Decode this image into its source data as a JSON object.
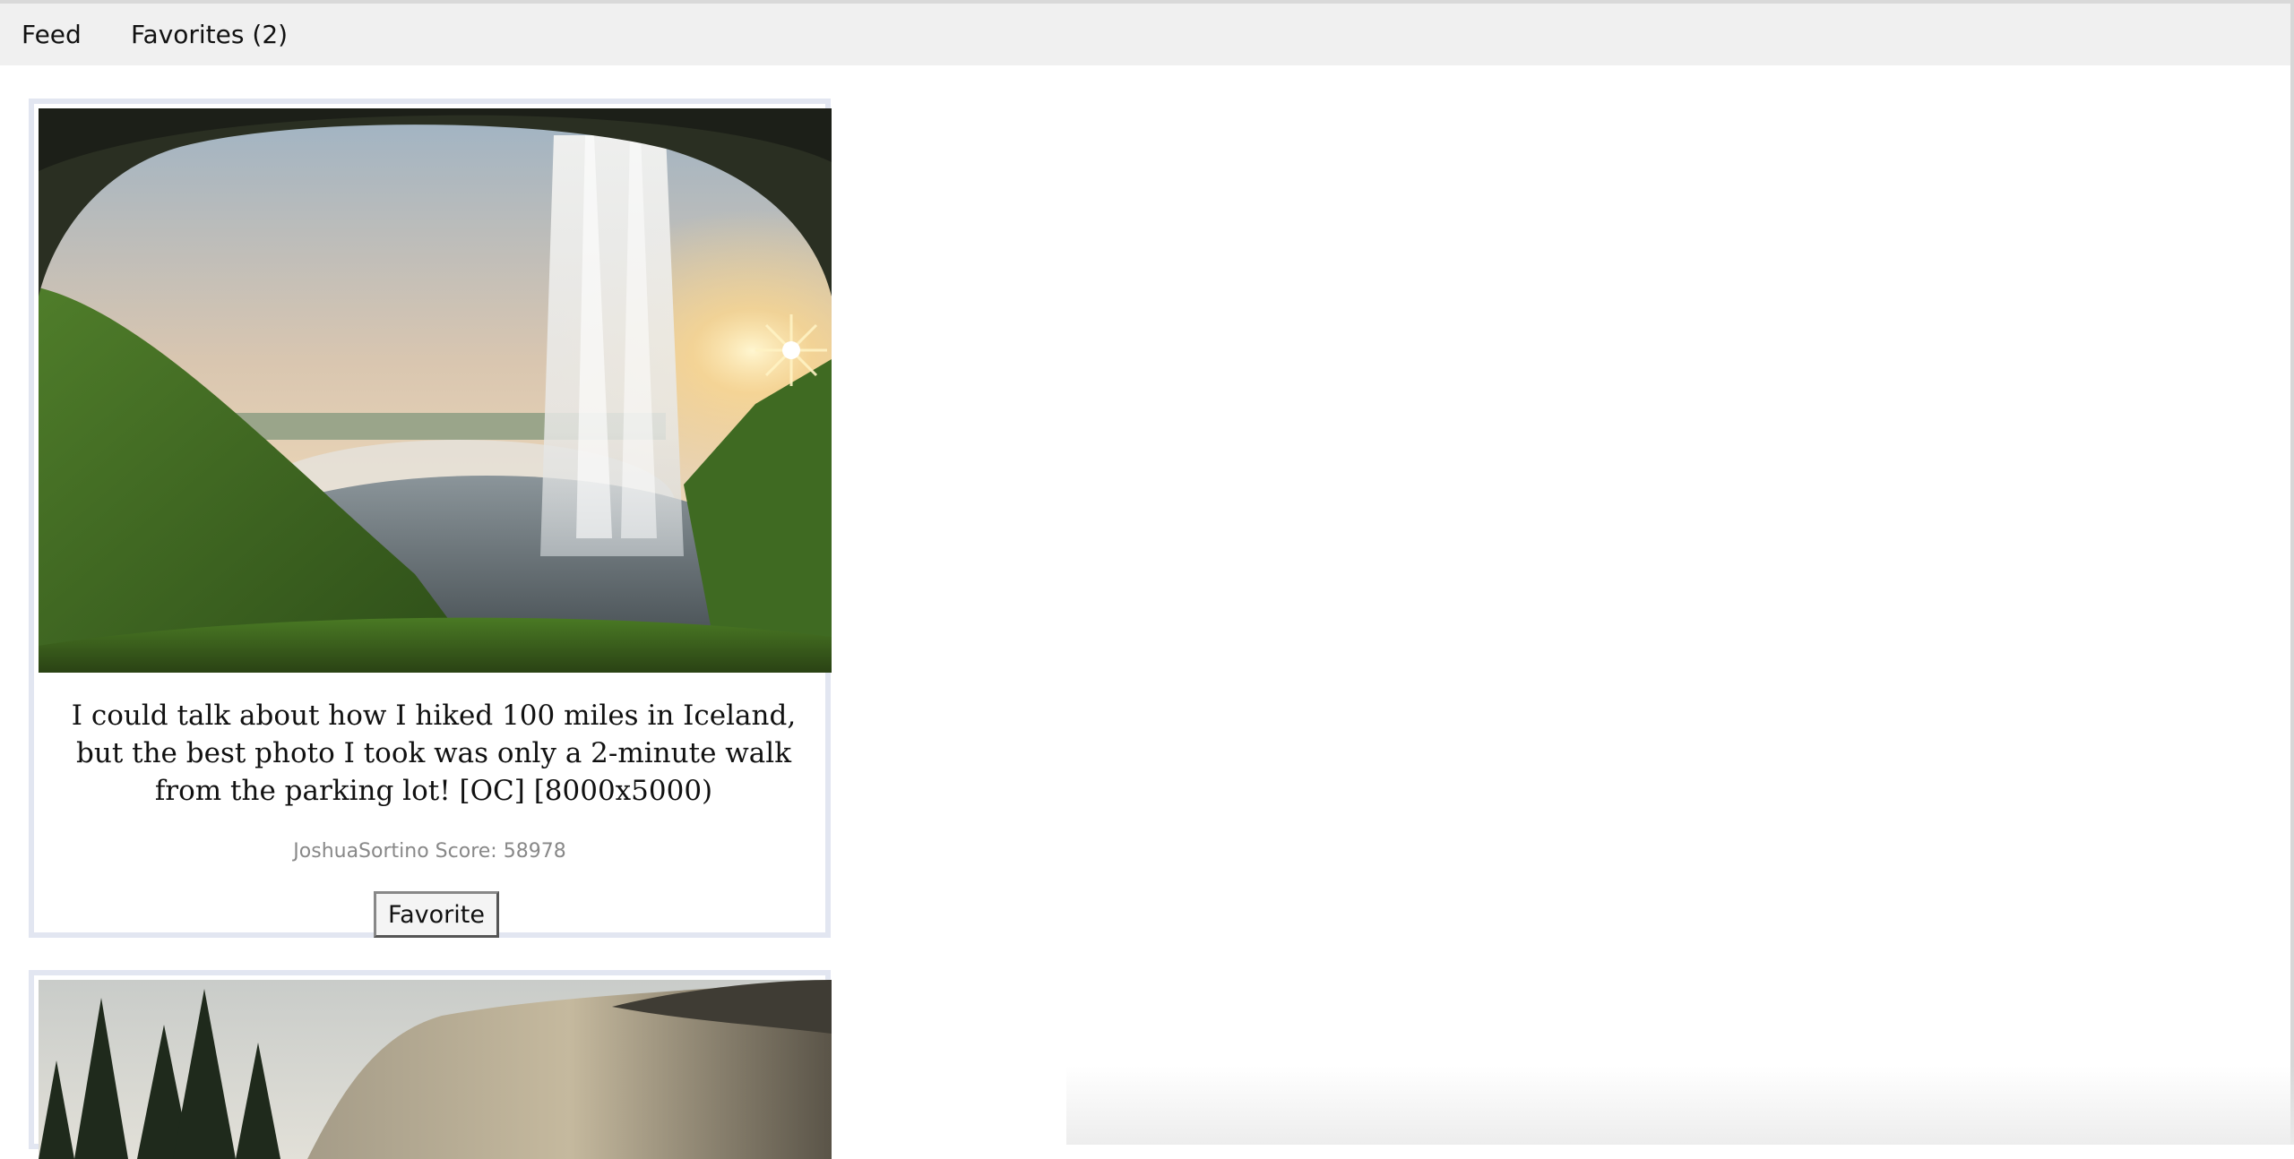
{
  "nav": {
    "feed_label": "Feed",
    "favorites_label": "Favorites",
    "favorites_count": "2"
  },
  "posts": [
    {
      "title": "I could talk about how I hiked 100 miles in Iceland, but the best photo I took was only a 2-minute walk from the parking lot! [OC] [8000x5000)",
      "author": "JoshuaSortino",
      "score_label": "Score:",
      "score": "58978",
      "button_label": "Favorite",
      "image_icon": "waterfall-cave-photo"
    },
    {
      "image_icon": "forest-cliff-photo"
    }
  ],
  "colors": {
    "nav_bg": "#f0f0f0",
    "card_border": "#e2e6f1",
    "meta_text": "#888888"
  }
}
